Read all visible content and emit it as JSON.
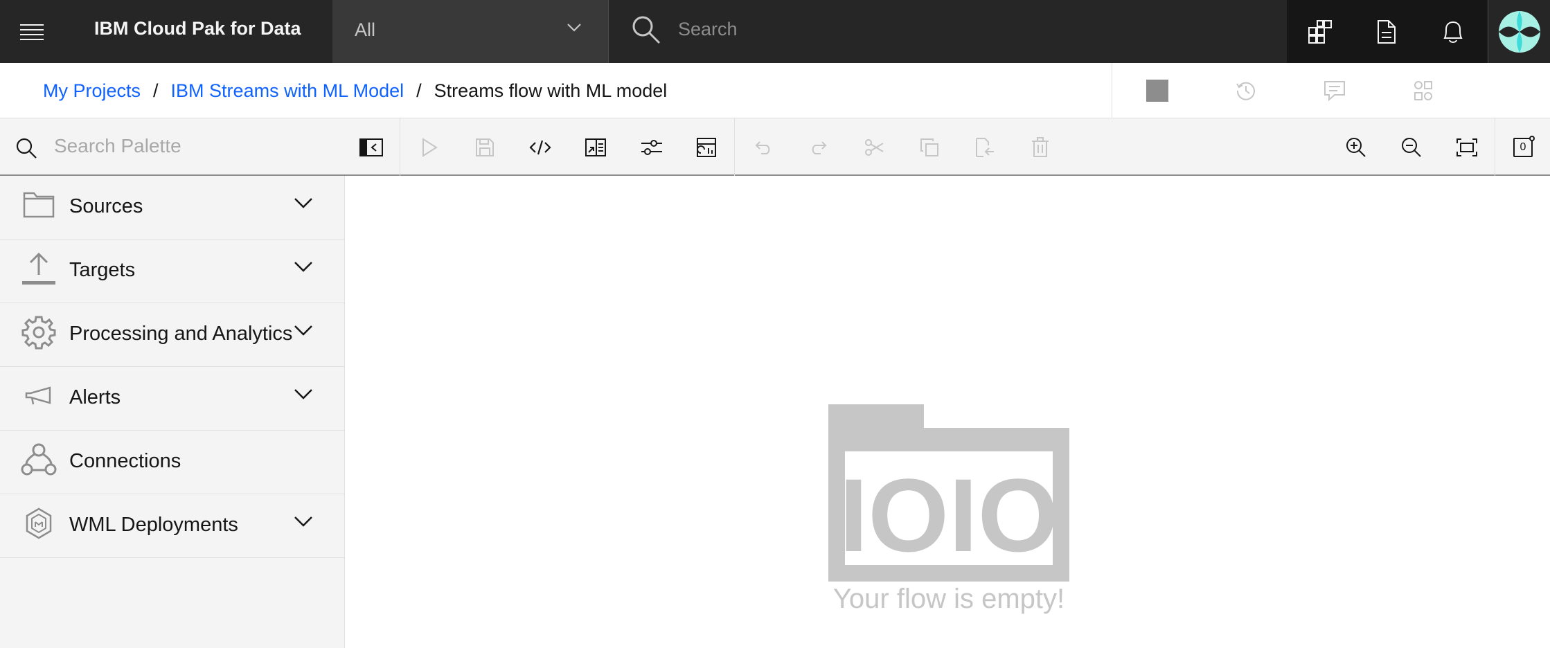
{
  "header": {
    "brand": "IBM Cloud Pak for Data",
    "scope_selected": "All",
    "search_placeholder": "Search"
  },
  "breadcrumb": {
    "items": [
      "My Projects",
      "IBM Streams with ML Model"
    ],
    "current": "Streams flow with ML model",
    "separator": "/"
  },
  "toolbar": {
    "palette_search_placeholder": "Search Palette",
    "notification_count": "0"
  },
  "palette": {
    "categories": [
      {
        "label": "Sources",
        "icon": "folder-icon",
        "expandable": true
      },
      {
        "label": "Targets",
        "icon": "upload-icon",
        "expandable": true
      },
      {
        "label": "Processing and Analytics",
        "icon": "gear-icon",
        "expandable": true
      },
      {
        "label": "Alerts",
        "icon": "megaphone-icon",
        "expandable": true
      },
      {
        "label": "Connections",
        "icon": "connection-icon",
        "expandable": false
      },
      {
        "label": "WML Deployments",
        "icon": "model-icon",
        "expandable": true
      }
    ]
  },
  "canvas": {
    "empty_message": "Your flow is empty!",
    "empty_art_text": "IOIO"
  },
  "colors": {
    "header_bg": "#262626",
    "link": "#0f62fe",
    "disabled_icon": "#c6c6c6",
    "empty_art": "#c6c6c6"
  }
}
